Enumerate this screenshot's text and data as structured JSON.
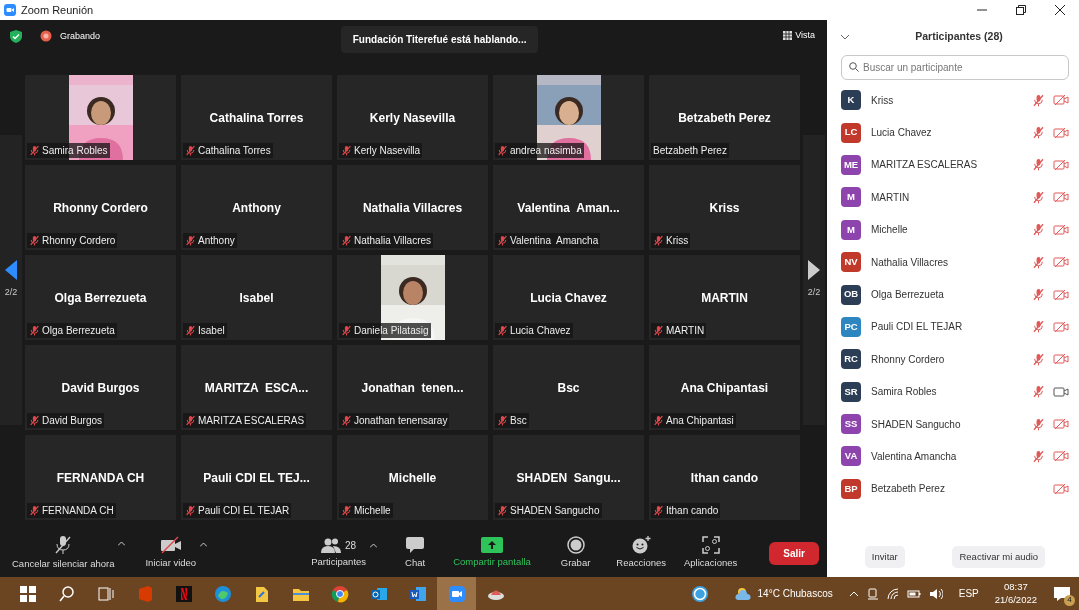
{
  "window": {
    "title": "Zoom Reunión"
  },
  "top_bar": {
    "recording": "Grabando",
    "speaker_toast": "Fundación Titerefué está hablando...",
    "view_button": "Vista"
  },
  "pager": {
    "previous_label": "2/2",
    "next_label": "2/2"
  },
  "tiles": [
    {
      "kind": "picture",
      "label": "Samira Robles",
      "muted": true
    },
    {
      "kind": "name",
      "title": "Cathalina Torres",
      "label": "Cathalina Torres",
      "muted": true
    },
    {
      "kind": "name",
      "title": "Kerly Nasevilla",
      "label": "Kerly Nasevilla",
      "muted": true
    },
    {
      "kind": "picture",
      "label": "andrea nasimba",
      "muted": true
    },
    {
      "kind": "name",
      "title": "Betzabeth Perez",
      "label": "Betzabeth Perez",
      "muted": false
    },
    {
      "kind": "name",
      "title": "Rhonny Cordero",
      "label": "Rhonny Cordero",
      "muted": true
    },
    {
      "kind": "name",
      "title": "Anthony",
      "label": "Anthony",
      "muted": true
    },
    {
      "kind": "name",
      "title": "Nathalia Villacres",
      "label": "Nathalia Villacres",
      "muted": true
    },
    {
      "kind": "name",
      "title": "Valentina  Aman...",
      "label": "Valentina  Amancha",
      "muted": true
    },
    {
      "kind": "name",
      "title": "Kriss",
      "label": "Kriss",
      "muted": true
    },
    {
      "kind": "name",
      "title": "Olga Berrezueta",
      "label": "Olga Berrezueta",
      "muted": true
    },
    {
      "kind": "name",
      "title": "Isabel",
      "label": "Isabel",
      "muted": true
    },
    {
      "kind": "picture",
      "label": "Daniela Pilatasig",
      "muted": true
    },
    {
      "kind": "name",
      "title": "Lucia Chavez",
      "label": "Lucia Chavez",
      "muted": true
    },
    {
      "kind": "name",
      "title": "MARTIN",
      "label": "MARTIN",
      "muted": true
    },
    {
      "kind": "name",
      "title": "David Burgos",
      "label": "David Burgos",
      "muted": true
    },
    {
      "kind": "name",
      "title": "MARITZA  ESCA...",
      "label": "MARITZA ESCALERAS",
      "muted": true
    },
    {
      "kind": "name",
      "title": "Jonathan  tenen...",
      "label": "Jonathan tenensaray",
      "muted": true
    },
    {
      "kind": "name",
      "title": "Bsc",
      "label": "Bsc",
      "muted": true
    },
    {
      "kind": "name",
      "title": "Ana Chipantasi",
      "label": "Ana Chipantasi",
      "muted": true
    },
    {
      "kind": "name",
      "title": "FERNANDA CH",
      "label": "FERNANDA CH",
      "muted": true
    },
    {
      "kind": "name",
      "title": "Pauli CDI EL TEJ...",
      "label": "Pauli CDI EL TEJAR",
      "muted": true
    },
    {
      "kind": "name",
      "title": "Michelle",
      "label": "Michelle",
      "muted": true
    },
    {
      "kind": "name",
      "title": "SHADEN  Sangu...",
      "label": "SHADEN Sangucho",
      "muted": true
    },
    {
      "kind": "name",
      "title": "Ithan cando",
      "label": "Ithan cando",
      "muted": true
    }
  ],
  "toolbar": [
    {
      "kind": "mic",
      "label": "Cancelar silenciar ahora",
      "caret": true
    },
    {
      "kind": "video",
      "label": "Iniciar video",
      "caret": true
    },
    {
      "kind": "people",
      "label": "Participantes",
      "count": "28",
      "caret": true
    },
    {
      "kind": "chat",
      "label": "Chat",
      "caret": false
    },
    {
      "kind": "share",
      "label": "Compartir pantalla",
      "caret": false
    },
    {
      "kind": "record",
      "label": "Grabar",
      "caret": false
    },
    {
      "kind": "reactions",
      "label": "Reacciones",
      "caret": false
    },
    {
      "kind": "apps",
      "label": "Aplicaciones",
      "caret": false
    }
  ],
  "leave_button": "Salir",
  "participants_panel": {
    "title": "Participantes (28)",
    "search": {
      "placeholder": "Buscar un participante"
    },
    "items": [
      {
        "initials": "K",
        "name": "Kriss",
        "color": "#2c3e55",
        "mic_muted": true,
        "video_off": true
      },
      {
        "initials": "LC",
        "name": "Lucia Chavez",
        "color": "#c0392b",
        "mic_muted": true,
        "video_off": true
      },
      {
        "initials": "ME",
        "name": "MARITZA ESCALERAS",
        "color": "#8e44ad",
        "mic_muted": true,
        "video_off": true
      },
      {
        "initials": "M",
        "name": "MARTIN",
        "color": "#8e44ad",
        "mic_muted": true,
        "video_off": true
      },
      {
        "initials": "M",
        "name": "Michelle",
        "color": "#8e44ad",
        "mic_muted": true,
        "video_off": true
      },
      {
        "initials": "NV",
        "name": "Nathalia Villacres",
        "color": "#c0392b",
        "mic_muted": true,
        "video_off": true
      },
      {
        "initials": "OB",
        "name": "Olga Berrezueta",
        "color": "#2c3e55",
        "mic_muted": true,
        "video_off": true
      },
      {
        "initials": "PC",
        "name": "Pauli CDI EL TEJAR",
        "color": "#2e86c1",
        "mic_muted": true,
        "video_off": true
      },
      {
        "initials": "RC",
        "name": "Rhonny Cordero",
        "color": "#2c3e55",
        "mic_muted": true,
        "video_off": true
      },
      {
        "initials": "SR",
        "name": "Samira Robles",
        "color": "#2c3e55",
        "mic_muted": true,
        "video_off": false
      },
      {
        "initials": "SS",
        "name": "SHADEN Sangucho",
        "color": "#8e44ad",
        "mic_muted": true,
        "video_off": true
      },
      {
        "initials": "VA",
        "name": "Valentina  Amancha",
        "color": "#8e44ad",
        "mic_muted": true,
        "video_off": true
      },
      {
        "initials": "BP",
        "name": "Betzabeth Perez",
        "color": "#c0392b",
        "mic_muted": false,
        "video_off": true
      }
    ],
    "buttons": [
      "Invitar",
      "Reactivar mi audio"
    ]
  },
  "taskbar": {
    "weather": "14°C Chubascos",
    "language": "ESP",
    "time": "08:37",
    "date": "21/6/2022",
    "notifications": "4"
  }
}
